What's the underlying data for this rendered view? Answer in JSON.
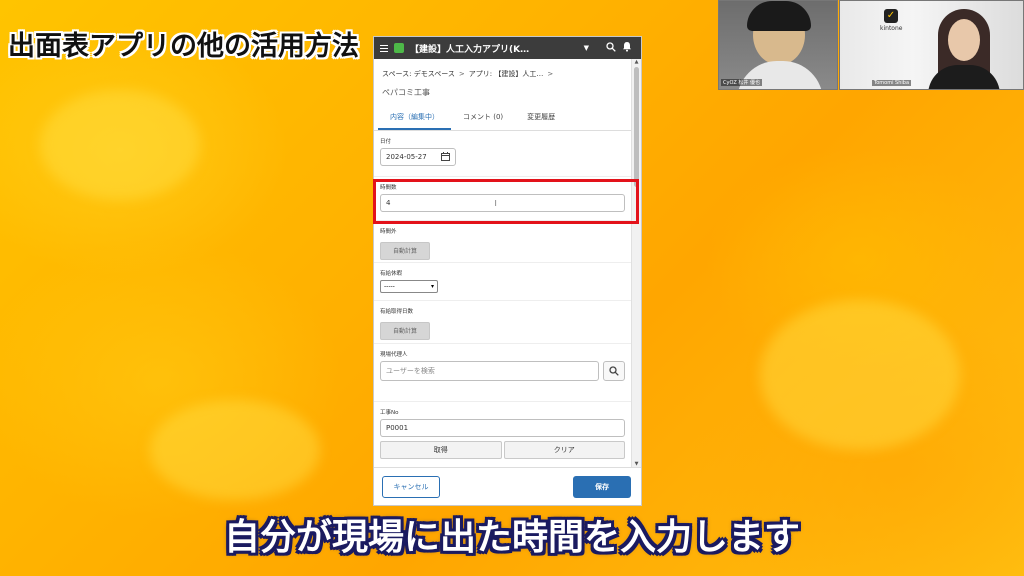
{
  "overlay_title": "出面表アプリの他の活用方法",
  "video": {
    "participant_1_name": "CyOZ 松井 優也",
    "participant_2_name": "Tomomi Shiba",
    "logo_text": "kintone"
  },
  "app": {
    "title": "【建設】人工入力アプリ(K…",
    "icons": [
      "menu-icon",
      "search-icon",
      "bell-icon"
    ]
  },
  "breadcrumb": {
    "space_label": "スペース: デモスペース",
    "app_label": "アプリ: 【建設】人工…"
  },
  "record_title": "ペパコミ工事",
  "tabs": [
    "内容（編集中）",
    "コメント (0)",
    "変更履歴"
  ],
  "fields": {
    "date": {
      "label": "日付",
      "value": "2024-05-27"
    },
    "hours_in": {
      "label": "時間数",
      "value": "4"
    },
    "hours_out": {
      "label": "時間外",
      "button": "自動計算"
    },
    "paid_leave": {
      "label": "有給休暇",
      "value": "-----"
    },
    "paid_leave_days": {
      "label": "有給取得日数",
      "button": "自動計算"
    },
    "site_agent": {
      "label": "現場代理人",
      "placeholder": "ユーザーを検索"
    },
    "construction_no": {
      "label": "工事No",
      "value": "P0001",
      "fetch_button": "取得",
      "clear_button": "クリア"
    }
  },
  "footer": {
    "cancel": "キャンセル",
    "save": "保存"
  },
  "colors": {
    "accent": "#2a6fb3",
    "highlight": "#e3121a",
    "background": "#ffb300"
  },
  "caption": "自分が現場に出た時間を入力します"
}
